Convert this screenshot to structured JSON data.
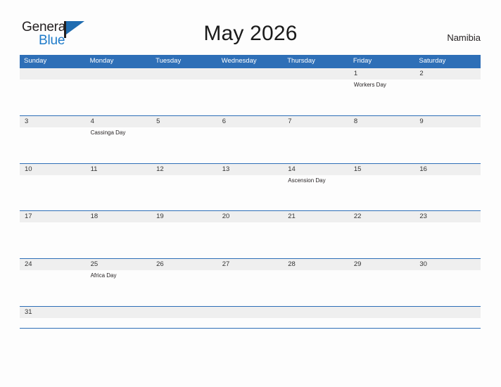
{
  "header": {
    "logo": {
      "text_top": "General",
      "text_bottom": "Blue",
      "flag_icon": "blue-flag-icon",
      "brand_blue": "#1d7ac9",
      "flag_blue": "#1f6cb0"
    },
    "title": "May 2026",
    "locale": "Namibia"
  },
  "theme": {
    "header_blue": "#2e6fb7",
    "date_band_gray": "#efefef",
    "page_background": "#fdfdfd",
    "text_dark": "#231f20"
  },
  "calendar": {
    "month": "May",
    "year": "2026",
    "day_headers": [
      "Sunday",
      "Monday",
      "Tuesday",
      "Wednesday",
      "Thursday",
      "Friday",
      "Saturday"
    ],
    "weeks": [
      {
        "days": [
          {
            "date": "",
            "event": ""
          },
          {
            "date": "",
            "event": ""
          },
          {
            "date": "",
            "event": ""
          },
          {
            "date": "",
            "event": ""
          },
          {
            "date": "",
            "event": ""
          },
          {
            "date": "1",
            "event": "Workers Day"
          },
          {
            "date": "2",
            "event": ""
          }
        ]
      },
      {
        "days": [
          {
            "date": "3",
            "event": ""
          },
          {
            "date": "4",
            "event": "Cassinga Day"
          },
          {
            "date": "5",
            "event": ""
          },
          {
            "date": "6",
            "event": ""
          },
          {
            "date": "7",
            "event": ""
          },
          {
            "date": "8",
            "event": ""
          },
          {
            "date": "9",
            "event": ""
          }
        ]
      },
      {
        "days": [
          {
            "date": "10",
            "event": ""
          },
          {
            "date": "11",
            "event": ""
          },
          {
            "date": "12",
            "event": ""
          },
          {
            "date": "13",
            "event": ""
          },
          {
            "date": "14",
            "event": "Ascension Day"
          },
          {
            "date": "15",
            "event": ""
          },
          {
            "date": "16",
            "event": ""
          }
        ]
      },
      {
        "days": [
          {
            "date": "17",
            "event": ""
          },
          {
            "date": "18",
            "event": ""
          },
          {
            "date": "19",
            "event": ""
          },
          {
            "date": "20",
            "event": ""
          },
          {
            "date": "21",
            "event": ""
          },
          {
            "date": "22",
            "event": ""
          },
          {
            "date": "23",
            "event": ""
          }
        ]
      },
      {
        "days": [
          {
            "date": "24",
            "event": ""
          },
          {
            "date": "25",
            "event": "Africa Day"
          },
          {
            "date": "26",
            "event": ""
          },
          {
            "date": "27",
            "event": ""
          },
          {
            "date": "28",
            "event": ""
          },
          {
            "date": "29",
            "event": ""
          },
          {
            "date": "30",
            "event": ""
          }
        ]
      },
      {
        "days": [
          {
            "date": "31",
            "event": ""
          },
          {
            "date": "",
            "event": ""
          },
          {
            "date": "",
            "event": ""
          },
          {
            "date": "",
            "event": ""
          },
          {
            "date": "",
            "event": ""
          },
          {
            "date": "",
            "event": ""
          },
          {
            "date": "",
            "event": ""
          }
        ]
      }
    ]
  }
}
